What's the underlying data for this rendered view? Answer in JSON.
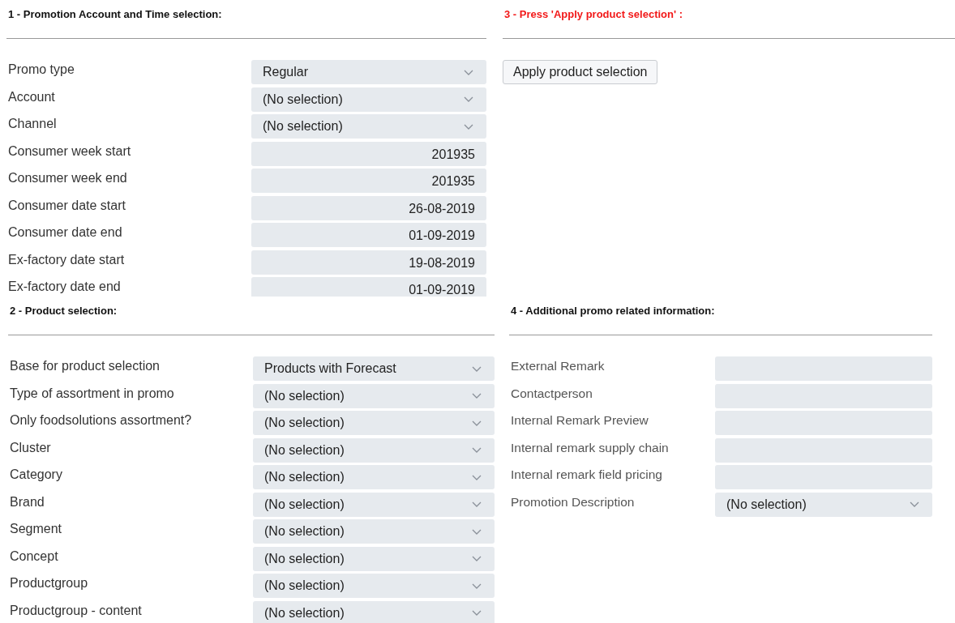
{
  "sections": [
    {
      "title": "1 - Promotion Account and Time selection:",
      "highlighted": false,
      "fields": [
        {
          "label": "Promo type",
          "kind": "dropdown",
          "value": "Regular"
        },
        {
          "label": "Account",
          "kind": "dropdown",
          "value": "(No selection)"
        },
        {
          "label": "Channel",
          "kind": "dropdown",
          "value": "(No selection)"
        },
        {
          "label": "Consumer week start",
          "kind": "text",
          "value": "201935"
        },
        {
          "label": "Consumer week end",
          "kind": "text",
          "value": "201935"
        },
        {
          "label": "Consumer date start",
          "kind": "text",
          "value": "26-08-2019"
        },
        {
          "label": "Consumer date end",
          "kind": "text",
          "value": "01-09-2019"
        },
        {
          "label": "Ex-factory date start",
          "kind": "text",
          "value": "19-08-2019"
        },
        {
          "label": "Ex-factory date end",
          "kind": "text",
          "value": "01-09-2019"
        }
      ]
    },
    {
      "title": "3 - Press 'Apply product selection' :",
      "highlighted": true,
      "button": "Apply product selection"
    },
    {
      "title": "2 - Product selection:",
      "highlighted": false,
      "fields": [
        {
          "label": "Base for product selection",
          "kind": "dropdown",
          "value": "Products with Forecast"
        },
        {
          "label": "Type of assortment in promo",
          "kind": "dropdown",
          "value": "(No selection)"
        },
        {
          "label": "Only foodsolutions assortment?",
          "kind": "dropdown",
          "value": "(No selection)"
        },
        {
          "label": "Cluster",
          "kind": "dropdown",
          "value": "(No selection)"
        },
        {
          "label": "Category",
          "kind": "dropdown",
          "value": "(No selection)"
        },
        {
          "label": "Brand",
          "kind": "dropdown",
          "value": "(No selection)"
        },
        {
          "label": "Segment",
          "kind": "dropdown",
          "value": "(No selection)"
        },
        {
          "label": "Concept",
          "kind": "dropdown",
          "value": "(No selection)"
        },
        {
          "label": "Productgroup",
          "kind": "dropdown",
          "value": "(No selection)"
        },
        {
          "label": "Productgroup - content",
          "kind": "dropdown",
          "value": "(No selection)"
        }
      ]
    },
    {
      "title": "4 - Additional promo related information:",
      "highlighted": false,
      "fields": [
        {
          "label": "External Remark",
          "kind": "text"
        },
        {
          "label": "Contactperson",
          "kind": "text"
        },
        {
          "label": "Internal Remark Preview",
          "kind": "text"
        },
        {
          "label": "Internal remark supply chain",
          "kind": "text"
        },
        {
          "label": "Internal remark field pricing",
          "kind": "text"
        },
        {
          "label": "Promotion Description",
          "kind": "dropdown",
          "value": "(No selection)"
        }
      ]
    }
  ]
}
